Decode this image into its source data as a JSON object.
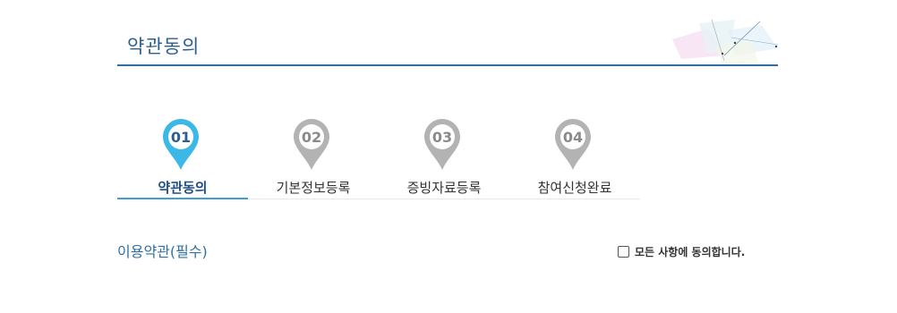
{
  "header": {
    "title": "약관동의"
  },
  "steps": [
    {
      "number": "01",
      "label": "약관동의",
      "active": true
    },
    {
      "number": "02",
      "label": "기본정보등록",
      "active": false
    },
    {
      "number": "03",
      "label": "증빙자료등록",
      "active": false
    },
    {
      "number": "04",
      "label": "참여신청완료",
      "active": false
    }
  ],
  "terms": {
    "section_title": "이용약관(필수)",
    "agree_all_label": "모든 사항에 동의합니다.",
    "agree_all_checked": false
  },
  "colors": {
    "accent": "#2f6ea6",
    "active_pin": "#3cb8e6",
    "inactive_pin": "#b3b3b3",
    "active_label": "#1e4f86"
  }
}
